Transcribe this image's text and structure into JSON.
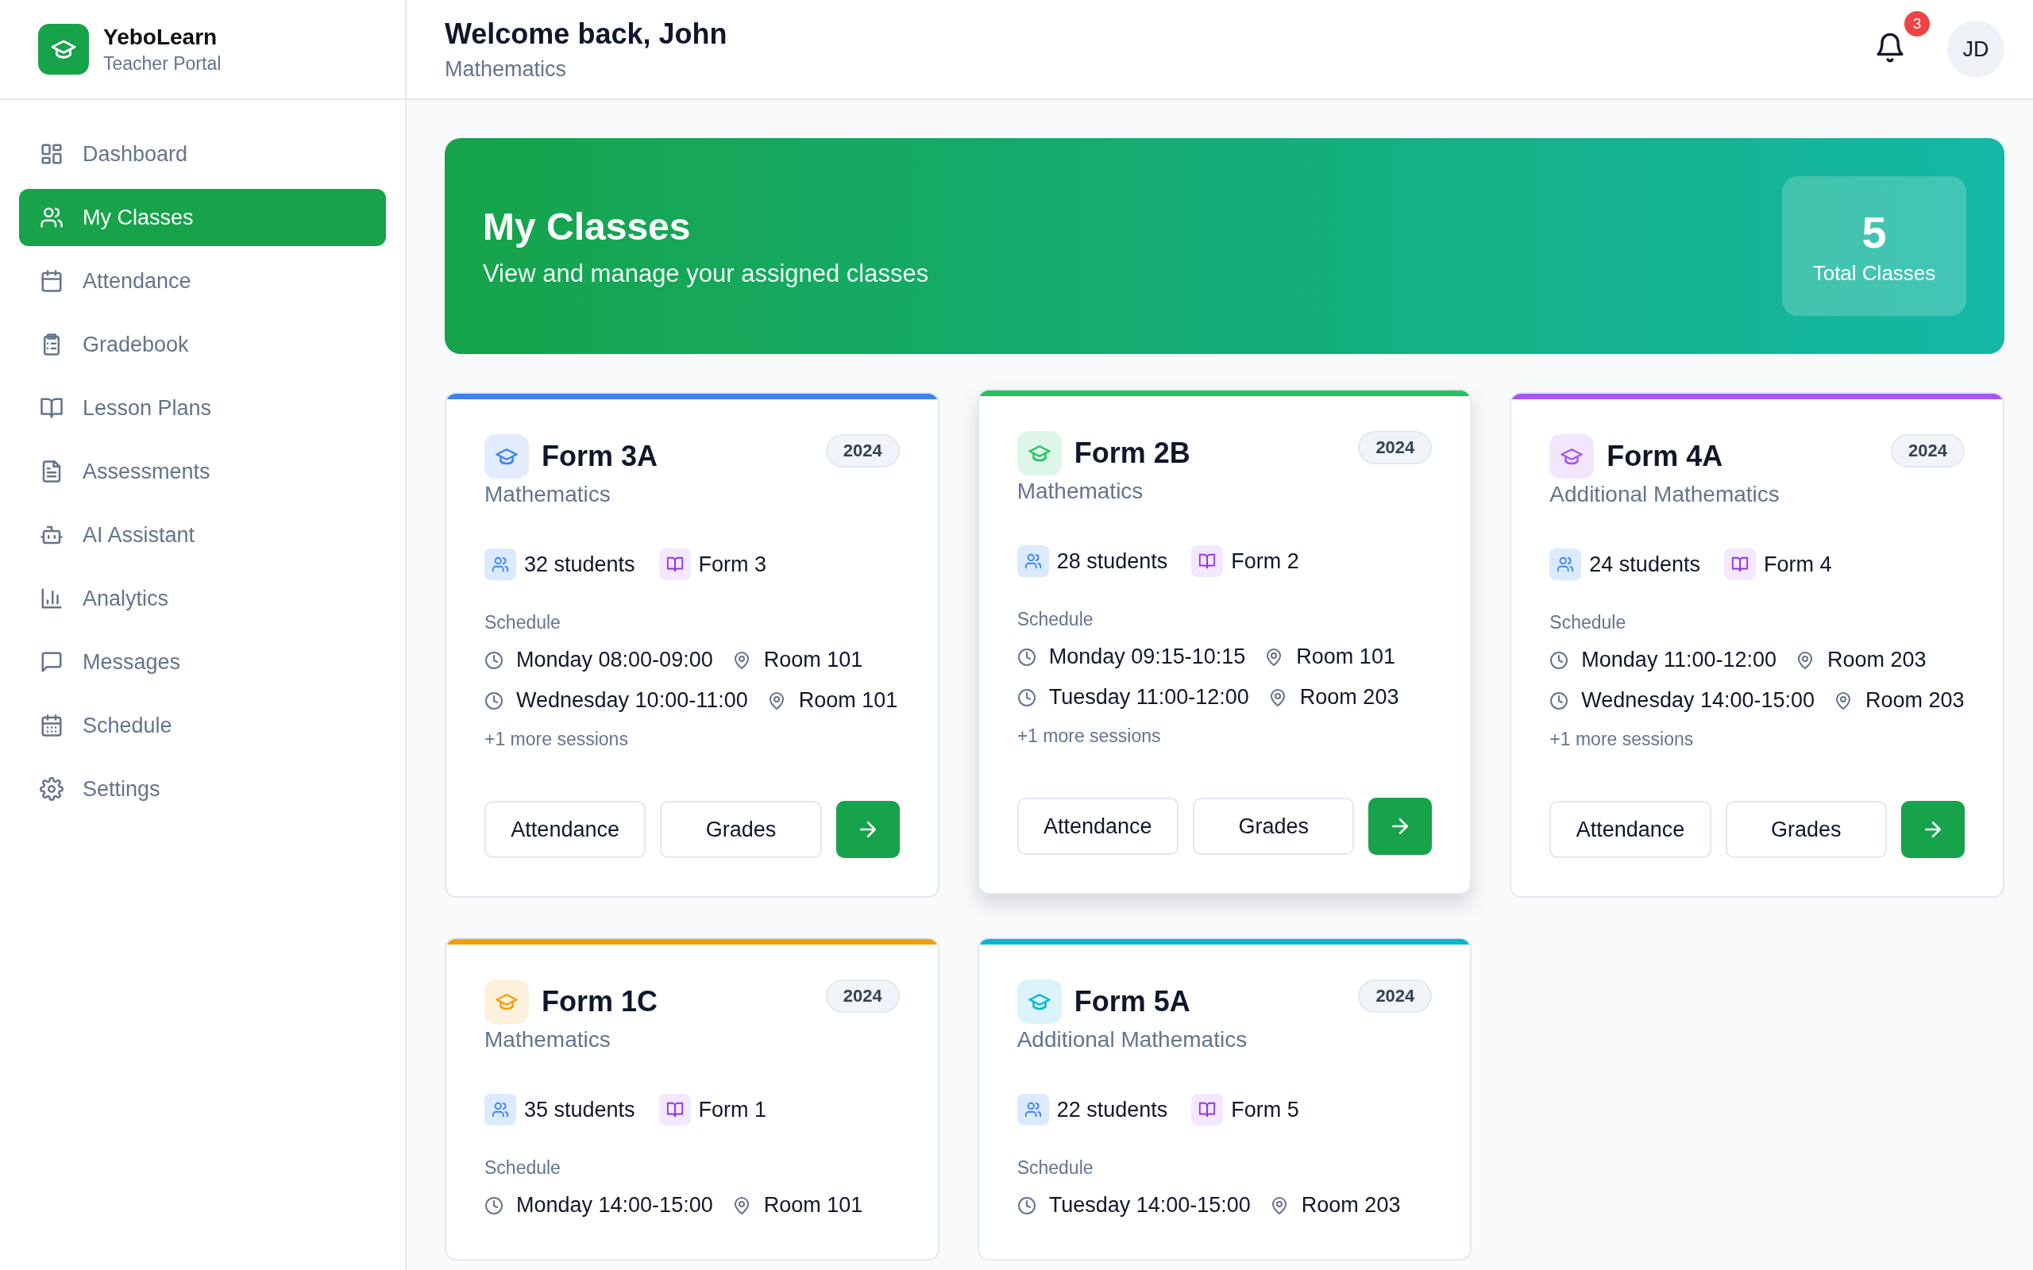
{
  "brand": {
    "name": "YeboLearn",
    "subtitle": "Teacher Portal"
  },
  "sidebar": {
    "items": [
      {
        "label": "Dashboard",
        "selected": false
      },
      {
        "label": "My Classes",
        "selected": true
      },
      {
        "label": "Attendance",
        "selected": false
      },
      {
        "label": "Gradebook",
        "selected": false
      },
      {
        "label": "Lesson Plans",
        "selected": false
      },
      {
        "label": "Assessments",
        "selected": false
      },
      {
        "label": "AI Assistant",
        "selected": false
      },
      {
        "label": "Analytics",
        "selected": false
      },
      {
        "label": "Messages",
        "selected": false
      },
      {
        "label": "Schedule",
        "selected": false
      },
      {
        "label": "Settings",
        "selected": false
      }
    ]
  },
  "header": {
    "title": "Welcome back, John",
    "subtitle": "Mathematics",
    "notification_count": "3",
    "avatar": "JD"
  },
  "hero": {
    "title": "My Classes",
    "subtitle": "View and manage your assigned classes",
    "stat_value": "5",
    "stat_label": "Total Classes"
  },
  "classes": [
    {
      "name": "Form 3A",
      "subject": "Mathematics",
      "year": "2024",
      "color": "#3b82f6",
      "hovered": false,
      "students": "32 students",
      "form": "Form 3",
      "schedule_label": "Schedule",
      "sessions": [
        {
          "time": "Monday 08:00-09:00",
          "room": "Room 101"
        },
        {
          "time": "Wednesday 10:00-11:00",
          "room": "Room 101"
        }
      ],
      "more": "+1 more sessions",
      "buttons": [
        "Attendance",
        "Grades"
      ]
    },
    {
      "name": "Form 2B",
      "subject": "Mathematics",
      "year": "2024",
      "color": "#22c55e",
      "hovered": true,
      "students": "28 students",
      "form": "Form 2",
      "schedule_label": "Schedule",
      "sessions": [
        {
          "time": "Monday 09:15-10:15",
          "room": "Room 101"
        },
        {
          "time": "Tuesday 11:00-12:00",
          "room": "Room 203"
        }
      ],
      "more": "+1 more sessions",
      "buttons": [
        "Attendance",
        "Grades"
      ]
    },
    {
      "name": "Form 4A",
      "subject": "Additional Mathematics",
      "year": "2024",
      "color": "#a855f7",
      "hovered": false,
      "students": "24 students",
      "form": "Form 4",
      "schedule_label": "Schedule",
      "sessions": [
        {
          "time": "Monday 11:00-12:00",
          "room": "Room 203"
        },
        {
          "time": "Wednesday 14:00-15:00",
          "room": "Room 203"
        }
      ],
      "more": "+1 more sessions",
      "buttons": [
        "Attendance",
        "Grades"
      ]
    },
    {
      "name": "Form 1C",
      "subject": "Mathematics",
      "year": "2024",
      "color": "#f59e0b",
      "hovered": false,
      "students": "35 students",
      "form": "Form 1",
      "schedule_label": "Schedule",
      "sessions": [
        {
          "time": "Monday 14:00-15:00",
          "room": "Room 101"
        }
      ]
    },
    {
      "name": "Form 5A",
      "subject": "Additional Mathematics",
      "year": "2024",
      "color": "#06b6d4",
      "hovered": false,
      "students": "22 students",
      "form": "Form 5",
      "schedule_label": "Schedule",
      "sessions": [
        {
          "time": "Tuesday 14:00-15:00",
          "room": "Room 203"
        }
      ]
    }
  ]
}
